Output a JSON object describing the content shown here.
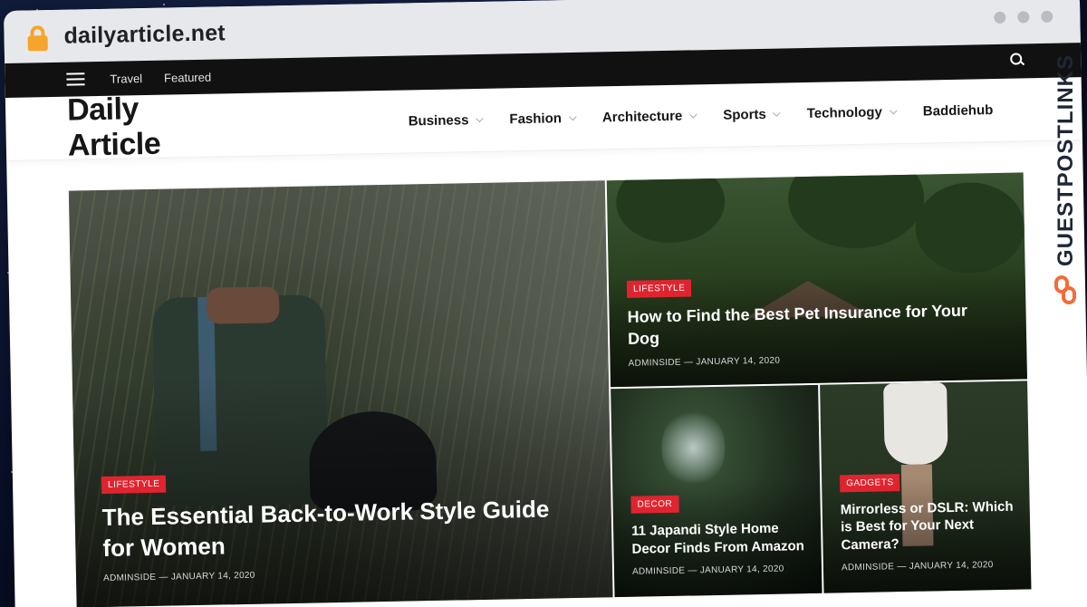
{
  "browser": {
    "url": "dailyarticle.net"
  },
  "topbar": {
    "links": [
      "Travel",
      "Featured"
    ],
    "icons": [
      "hamburger-icon",
      "search-icon"
    ]
  },
  "header": {
    "logo": "Daily Article",
    "nav": [
      {
        "label": "Business",
        "has_dropdown": true
      },
      {
        "label": "Fashion",
        "has_dropdown": true
      },
      {
        "label": "Architecture",
        "has_dropdown": true
      },
      {
        "label": "Sports",
        "has_dropdown": true
      },
      {
        "label": "Technology",
        "has_dropdown": true
      },
      {
        "label": "Baddiehub",
        "has_dropdown": false
      }
    ]
  },
  "featured": [
    {
      "category": "LIFESTYLE",
      "title": "The Essential Back-to-Work Style Guide for Women",
      "author": "ADMINSIDE",
      "date": "JANUARY 14, 2020"
    },
    {
      "category": "LIFESTYLE",
      "title": "How to Find the Best Pet Insurance for Your Dog",
      "author": "ADMINSIDE",
      "date": "JANUARY 14, 2020"
    },
    {
      "category": "DECOR",
      "title": "11 Japandi Style Home Decor Finds From Amazon",
      "author": "ADMINSIDE",
      "date": "JANUARY 14, 2020"
    },
    {
      "category": "GADGETS",
      "title": "Mirrorless or DSLR: Which is Best for Your Next Camera?",
      "author": "ADMINSIDE",
      "date": "JANUARY 14, 2020"
    }
  ],
  "meta_separator": "—",
  "watermark": {
    "text": "GUESTPOSTLINKS",
    "icon": "chain-link-icon"
  },
  "colors": {
    "category_badge": "#e0242f",
    "lock": "#f6a52a",
    "watermark_icon": "#f26b3a"
  }
}
